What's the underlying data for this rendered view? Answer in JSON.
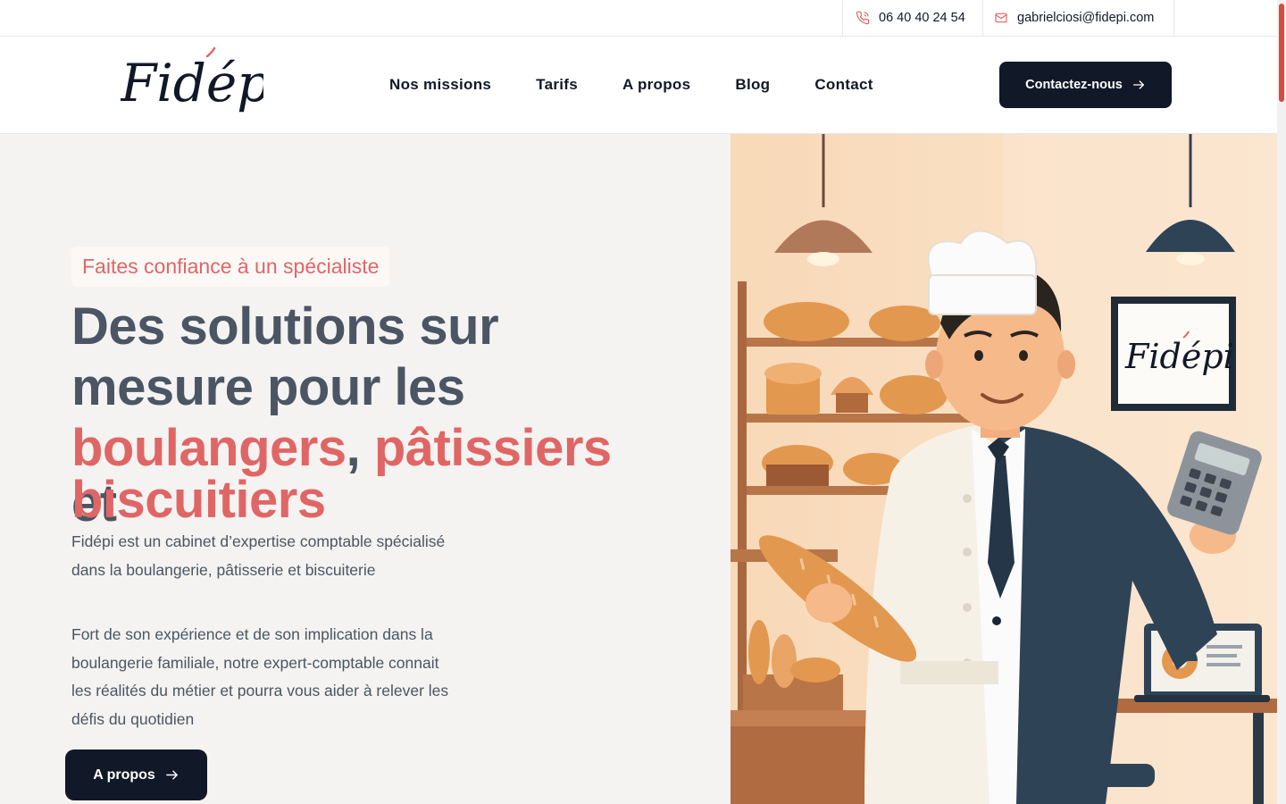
{
  "topbar": {
    "phone": "06 40 40 24 54",
    "email": "gabrielciosi@fidepi.com"
  },
  "header": {
    "logo_text": "Fidépi",
    "nav": [
      {
        "label": "Nos missions"
      },
      {
        "label": "Tarifs"
      },
      {
        "label": "A propos"
      },
      {
        "label": "Blog"
      },
      {
        "label": "Contact"
      }
    ],
    "cta_label": "Contactez-nous"
  },
  "hero": {
    "badge": "Faites confiance à un spécialiste",
    "headline": {
      "line1": "Des solutions sur",
      "line2": "mesure pour les",
      "word_boulangers": "boulangers",
      "comma": ",",
      "word_patissiers": "pâtissiers",
      "word_et": "et",
      "word_biscuitiers": "biscuitiers"
    },
    "desc1": "Fidépi est un cabinet d’expertise comptable spécialisé dans la boulangerie, pâtisserie et biscuiterie",
    "desc2": "Fort de son expérience et de son implication dans la boulangerie familiale, notre expert-comptable connait les réalités du métier et pourra vous aider à relever les défis du quotidien",
    "button_label": "A propos",
    "illustration_sign": "Fidépi"
  },
  "colors": {
    "accent": "#e06666",
    "dark": "#111827",
    "hero_bg": "#f4f3f1",
    "scroll_thumb": "#d84a3b"
  },
  "icons": {
    "phone": "phone-icon",
    "mail": "mail-icon",
    "arrow": "arrow-right-icon"
  }
}
